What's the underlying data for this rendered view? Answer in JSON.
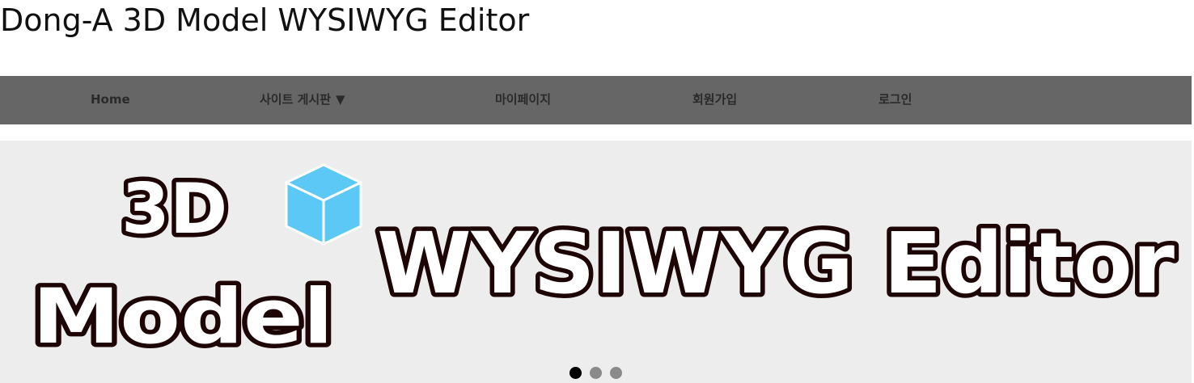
{
  "header": {
    "title": "Dong-A 3D Model WYSIWYG Editor"
  },
  "nav": {
    "items": [
      {
        "label": "Home"
      },
      {
        "label": "사이트 게시판",
        "caret": "▼"
      },
      {
        "label": "마이페이지"
      },
      {
        "label": "회원가입"
      },
      {
        "label": "로그인"
      }
    ]
  },
  "carousel": {
    "banner": {
      "line1": "3D",
      "line2": "Model",
      "headline": "WYSIWYG Editor",
      "icon": "cube-icon",
      "icon_color": "#5bc8f5"
    },
    "slide_count": 3,
    "active_slide": 1
  },
  "colors": {
    "navbar_bg": "#666666",
    "carousel_bg": "#ededed",
    "banner_outline": "#1d0505",
    "dot_active": "#000000",
    "dot_inactive": "#8a8a8a"
  }
}
